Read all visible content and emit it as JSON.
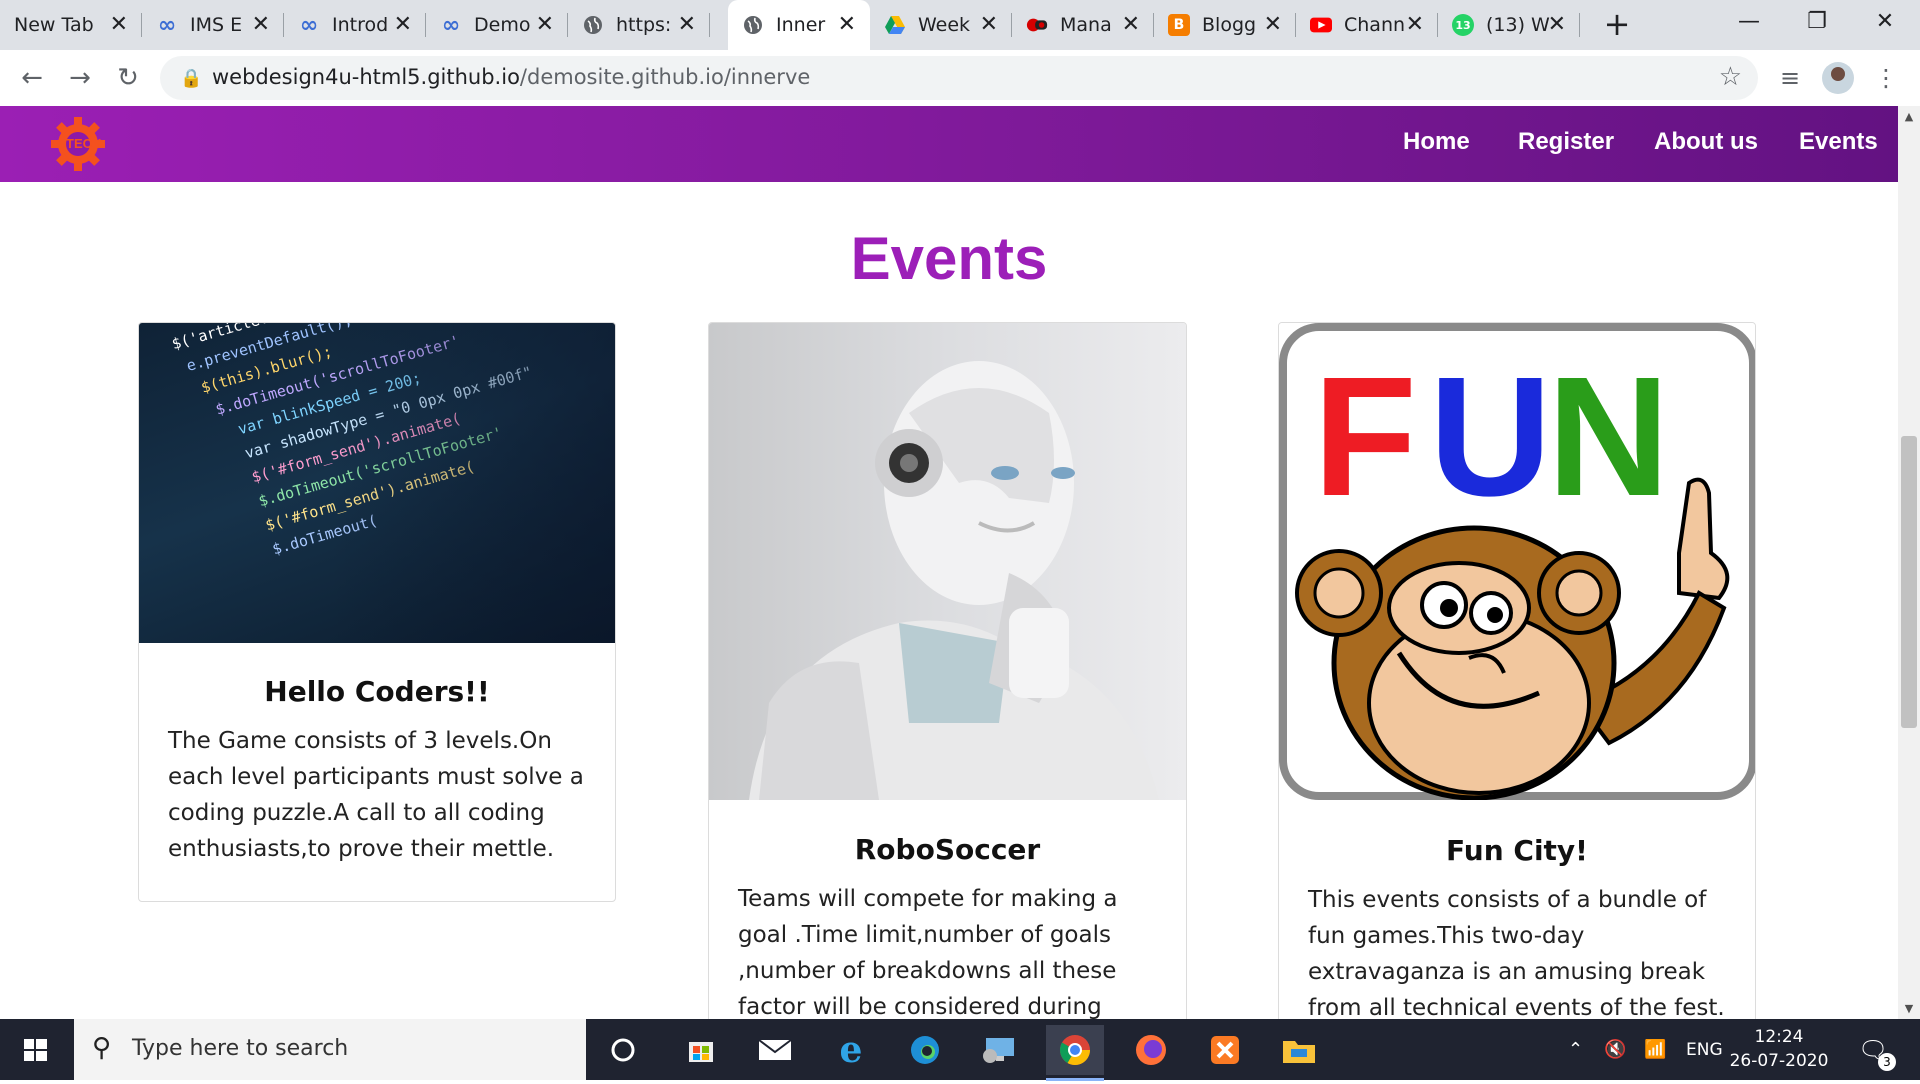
{
  "browser": {
    "tabs": [
      {
        "label": "New Tab",
        "icon": "none"
      },
      {
        "label": "IMS E",
        "icon": "infinity-icon"
      },
      {
        "label": "Introd",
        "icon": "infinity-icon"
      },
      {
        "label": "Demo",
        "icon": "infinity-icon"
      },
      {
        "label": "https:",
        "icon": "globe-icon"
      },
      {
        "label": "Inner",
        "icon": "globe-icon",
        "active": true
      },
      {
        "label": "Week",
        "icon": "drive-icon"
      },
      {
        "label": "Mana",
        "icon": "media-icon"
      },
      {
        "label": "Blogg",
        "icon": "blogger-icon"
      },
      {
        "label": "Chann",
        "icon": "youtube-icon"
      },
      {
        "label": "(13) W",
        "icon": "whatsapp-icon"
      }
    ],
    "whatsapp_badge": "13",
    "url_host": "webdesign4u-html5.github.io",
    "url_path": "/demosite.github.io/innerve"
  },
  "site": {
    "logo_text": "TECH",
    "nav": {
      "home": "Home",
      "register": "Register",
      "about": "About us",
      "events": "Events"
    },
    "section_title": "Events",
    "cards": [
      {
        "title": "Hello Coders!!",
        "text": "The Game consists of 3 levels.On each level participants must solve a coding puzzle.A call to all coding enthusiasts,to prove their mettle.",
        "image": "code-screen-image",
        "code_lines": [
          "$('article.carousel_item a')",
          "e.preventDefault();",
          "$(this).blur();",
          "$.doTimeout('scrollToFooter'",
          "var blinkSpeed = 200;",
          "var shadowType = \"0 0px 0px #00f\"",
          "$('#form_send').animate(",
          "$.doTimeout('scrollToFooter'",
          "$('#form_send').animate(",
          "$.doTimeout("
        ]
      },
      {
        "title": "RoboSoccer",
        "text": "Teams will compete for making a goal .Time limit,number of goals ,number of breakdowns all these factor will be considered during judgement.",
        "image": "robot-image"
      },
      {
        "title": "Fun City!",
        "text": "This events consists of a bundle of fun games.This two-day extravaganza is an amusing break from all technical events of the fest.",
        "image": "fun-monkey-image",
        "image_word": "FUN"
      }
    ]
  },
  "taskbar": {
    "search_placeholder": "Type here to search",
    "language": "ENG",
    "time": "12:24",
    "date": "26-07-2020",
    "notification_count": "3"
  },
  "colors": {
    "nav_gradient_start": "#9b1fb4",
    "nav_gradient_end": "#631282",
    "title_purple": "#9c1fb8",
    "logo_orange": "#f4511e"
  }
}
